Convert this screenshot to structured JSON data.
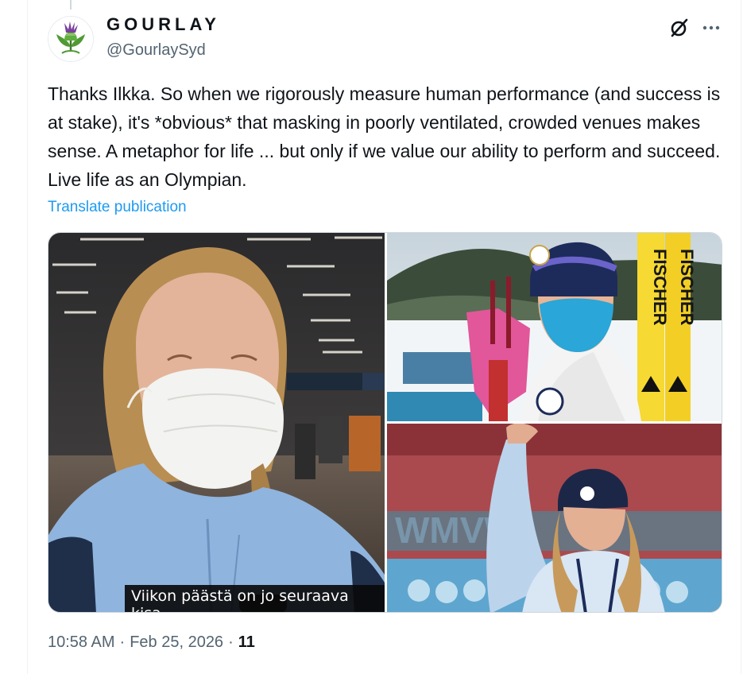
{
  "author": {
    "display_name": "GOURLAY",
    "handle": "@GourlaySyd",
    "avatar_icon": "thistle-icon"
  },
  "tweet": {
    "text": "Thanks Ilkka. So when we rigorously measure human performance (and success is at stake), it's *obvious* that masking in poorly ventilated, crowded venues makes sense. A metaphor for life ... but only if we value our ability to perform and succeed. Live life as an Olympian.",
    "translate_label": "Translate publication"
  },
  "media": {
    "photo_1_subtitle": "Viikon päästä on jo seuraava kisa",
    "photo_2_ski_text": "FISCHER"
  },
  "meta": {
    "time": "10:58 AM",
    "separator": "·",
    "date": "Feb 25, 2026",
    "views": "11"
  },
  "colors": {
    "accent": "#1d9bf0",
    "text": "#0f1419",
    "secondary": "#536471",
    "border": "#cfd9de"
  }
}
